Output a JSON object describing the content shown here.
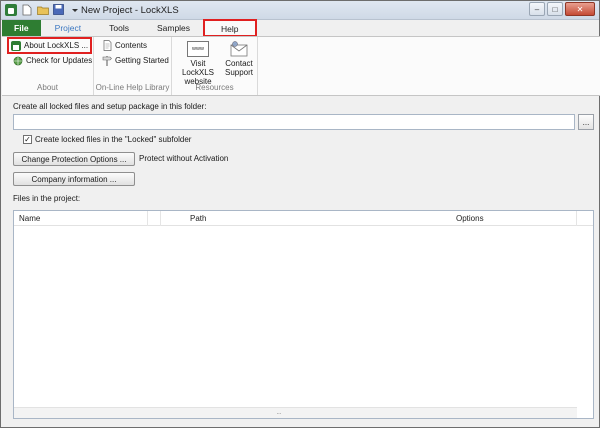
{
  "window": {
    "title": "New Project - LockXLS"
  },
  "qat": {
    "icons": [
      "app-icon",
      "new-file-icon",
      "open-folder-icon",
      "save-icon",
      "dropdown-icon"
    ]
  },
  "controls": {
    "minimize": "–",
    "maximize": "□",
    "close": "✕"
  },
  "tabs": [
    {
      "label": "File"
    },
    {
      "label": "Project"
    },
    {
      "label": "Tools"
    },
    {
      "label": "Samples"
    },
    {
      "label": "Help"
    }
  ],
  "ribbon": {
    "about": {
      "about_label": "About LockXLS ...",
      "updates_label": "Check for Updates",
      "group_label": "About"
    },
    "help_library": {
      "contents_label": "Contents",
      "getting_started_label": "Getting Started",
      "group_label": "On-Line Help Library"
    },
    "resources": {
      "website_line1": "Visit LockXLS",
      "website_line2": "website",
      "website_icon_text": "www",
      "support_line1": "Contact",
      "support_line2": "Support",
      "group_label": "Resources"
    }
  },
  "main": {
    "folder_label": "Create all locked files and setup package in this folder:",
    "folder_value": "",
    "browse_label": "...",
    "subfolder_checkbox": {
      "checked": true,
      "label": "Create locked files in the \"Locked\" subfolder"
    },
    "protection_button": "Change Protection Options ...",
    "protection_status": "Protect without Activation",
    "company_button": "Company information ...",
    "files_label": "Files in the project:",
    "table": {
      "columns": [
        "Name",
        "Path",
        "Options"
      ],
      "rows": [],
      "scroll_grip": "..."
    }
  }
}
